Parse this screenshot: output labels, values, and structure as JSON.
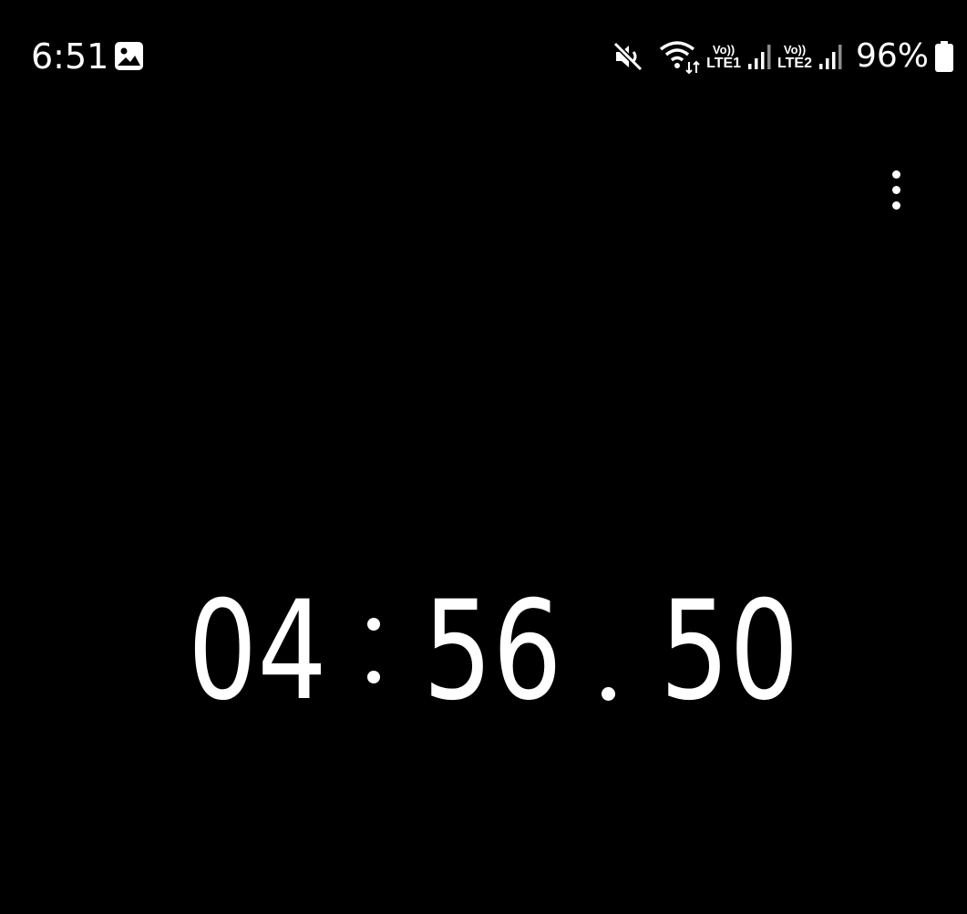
{
  "status_bar": {
    "time": "6:51",
    "notification_icon": "gallery-image-icon",
    "mute_icon": "volume-muted-icon",
    "wifi_icon": "wifi-icon",
    "sim1": {
      "top": "Vo))",
      "bottom": "LTE1",
      "signal_icon": "signal-bars-icon"
    },
    "sim2": {
      "top": "Vo))",
      "bottom": "LTE2",
      "signal_icon": "signal-bars-icon"
    },
    "battery_text": "96%",
    "battery_icon": "battery-icon"
  },
  "toolbar": {
    "more_icon": "more-options-icon"
  },
  "stopwatch": {
    "minutes": "04",
    "seconds": "56",
    "centiseconds": "50"
  },
  "colors": {
    "background": "#000000",
    "foreground": "#ffffff"
  }
}
